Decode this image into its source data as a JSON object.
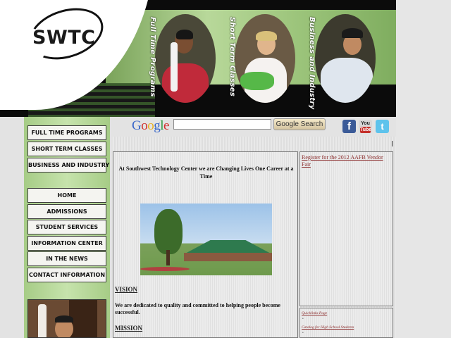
{
  "header": {
    "logo_text": "SWTC",
    "banner_labels": [
      "Full Time Programs",
      "Short Term Classes",
      "Business and Industry"
    ]
  },
  "search": {
    "google_letters": [
      "G",
      "o",
      "o",
      "g",
      "l",
      "e"
    ],
    "google_colors": [
      "#3a67c9",
      "#d0312d",
      "#e8b022",
      "#3a67c9",
      "#2c9a3f",
      "#d0312d"
    ],
    "input_value": "",
    "button_label": "Google Search"
  },
  "social": {
    "facebook": "f",
    "youtube_top": "You",
    "youtube_bottom": "Tube",
    "twitter": "t"
  },
  "sidebar": {
    "program_buttons": [
      {
        "label": "FULL TIME PROGRAMS"
      },
      {
        "label": "SHORT TERM CLASSES"
      },
      {
        "label": "BUSINESS AND INDUSTRY"
      }
    ],
    "nav_buttons": [
      {
        "label": "HOME"
      },
      {
        "label": "ADMISSIONS"
      },
      {
        "label": "STUDENT SERVICES"
      },
      {
        "label": "INFORMATION CENTER"
      },
      {
        "label": "IN THE NEWS"
      },
      {
        "label": "CONTACT INFORMATION"
      }
    ]
  },
  "main": {
    "headline": "At Southwest Technology Center we are Changing Lives One Career at a Time",
    "vision_title": "VISION",
    "vision_text": "We are dedicated to quality and committed to helping people become successful.",
    "mission_title": "MISSION"
  },
  "right": {
    "vendor_link": "Register for the 2012 AAFB Vendor Fair",
    "links": [
      "Quicklinks Page",
      "Catalog for High School Students"
    ]
  },
  "colors": {
    "sidebar_green": "#b5d898",
    "link_red": "#8b2d2d",
    "banner_black": "#0b0b0b"
  }
}
